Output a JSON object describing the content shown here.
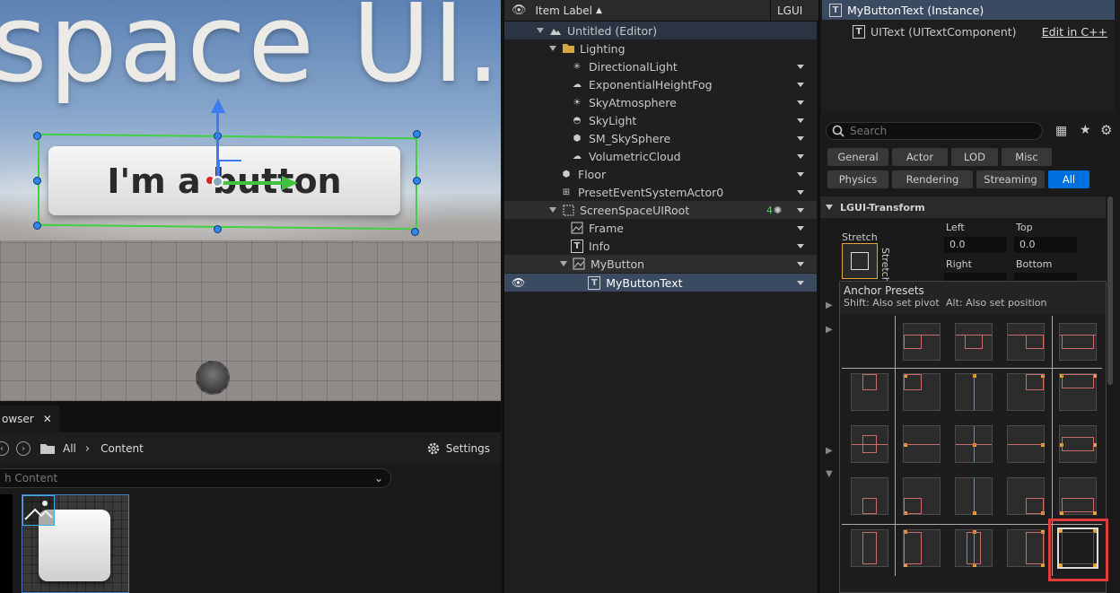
{
  "viewport": {
    "big_text": "space UI.",
    "button_text": "I'm a button"
  },
  "content_browser": {
    "tab_label": "owser",
    "tab_close": "✕",
    "path_all": "All",
    "path_content": "Content",
    "settings_label": "Settings",
    "search_placeholder": "h Content"
  },
  "outliner": {
    "header_label": "Item Label",
    "header_sort": "▲",
    "header_lgui": "LGUI",
    "items": [
      {
        "label": "Untitled (Editor)"
      },
      {
        "label": "Lighting"
      },
      {
        "label": "DirectionalLight"
      },
      {
        "label": "ExponentialHeightFog"
      },
      {
        "label": "SkyAtmosphere"
      },
      {
        "label": "SkyLight"
      },
      {
        "label": "SM_SkySphere"
      },
      {
        "label": "VolumetricCloud"
      },
      {
        "label": "Floor"
      },
      {
        "label": "PresetEventSystemActor0"
      },
      {
        "label": "ScreenSpaceUIRoot",
        "badge": "4"
      },
      {
        "label": "Frame"
      },
      {
        "label": "Info"
      },
      {
        "label": "MyButton"
      },
      {
        "label": "MyButtonText"
      }
    ]
  },
  "details": {
    "component_instance": "MyButtonText (Instance)",
    "component_text": "UIText (UITextComponent)",
    "edit_cpp": "Edit in C++",
    "search_placeholder": "Search",
    "filters_row1": [
      "General",
      "Actor",
      "LOD",
      "Misc"
    ],
    "filters_row2": [
      "Physics",
      "Rendering",
      "Streaming",
      "All"
    ],
    "section_title": "LGUI-Transform",
    "stretch_label": "Stretch",
    "stretch_vertical": "Stretch",
    "left_label": "Left",
    "left_value": "0.0",
    "top_label": "Top",
    "top_value": "0.0",
    "right_label": "Right",
    "bottom_label": "Bottom"
  },
  "anchor_presets": {
    "title": "Anchor Presets",
    "shift_hint": "Shift: Also set pivot",
    "alt_hint": "Alt: Also set position"
  },
  "colors": {
    "accent_blue": "#0070e0",
    "selected_row": "#3a4a60",
    "highlight_red": "#e23b3b",
    "anchor_dot": "#e8a23a"
  }
}
